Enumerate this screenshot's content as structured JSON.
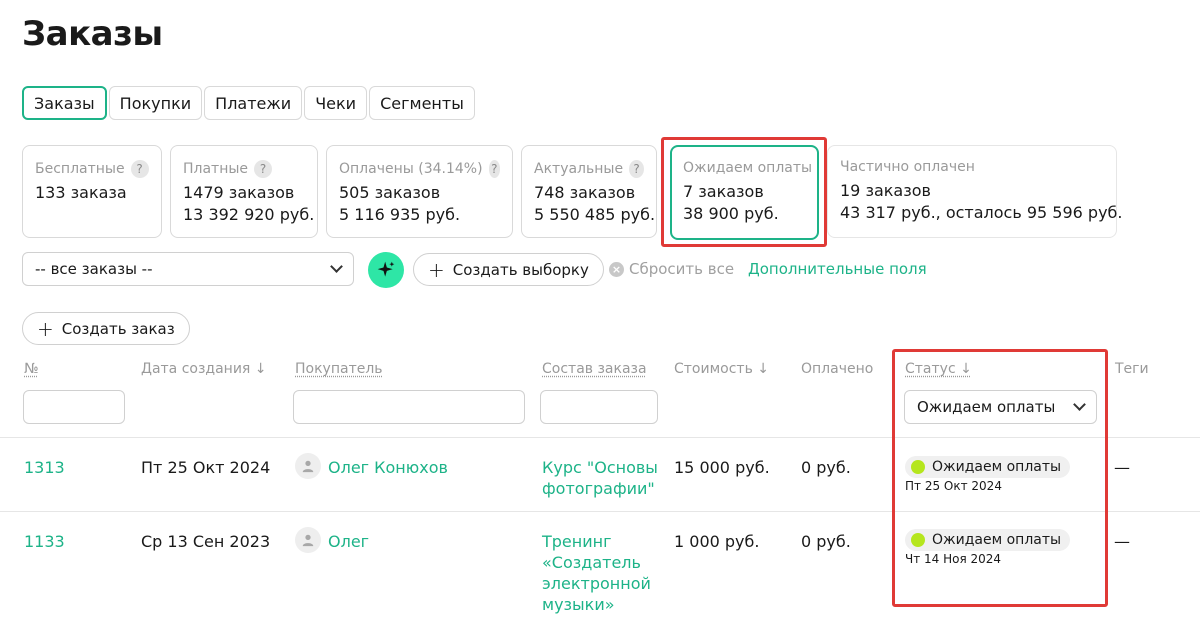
{
  "page": {
    "title": "Заказы"
  },
  "tabs": [
    {
      "label": "Заказы",
      "active": true
    },
    {
      "label": "Покупки"
    },
    {
      "label": "Платежи"
    },
    {
      "label": "Чеки"
    },
    {
      "label": "Сегменты"
    }
  ],
  "cards": [
    {
      "title": "Бесплатные",
      "line1": "133 заказа",
      "line2": ""
    },
    {
      "title": "Платные",
      "line1": "1479 заказов",
      "line2": "13 392 920 руб."
    },
    {
      "title": "Оплачены (34.14%)",
      "line1": "505 заказов",
      "line2": "5 116 935 руб."
    },
    {
      "title": "Актуальные",
      "line1": "748 заказов",
      "line2": "5 550 485 руб."
    },
    {
      "title": "Ожидаем оплаты",
      "line1": "7 заказов",
      "line2": "38 900 руб."
    },
    {
      "title": "Частично оплачен",
      "line1": "19 заказов",
      "line2": "43 317 руб., осталось 95 596 руб."
    }
  ],
  "help_glyph": "?",
  "filters": {
    "segment_select": "-- все заказы --",
    "create_selection": "Создать выборку",
    "reset_all": "Сбросить все",
    "extra_fields": "Дополнительные поля",
    "create_order": "Создать заказ"
  },
  "table": {
    "headers": {
      "number": "№",
      "created": "Дата создания ↓",
      "buyer": "Покупатель",
      "composition": "Состав заказа",
      "price": "Стоимость ↓",
      "paid": "Оплачено",
      "status": "Статус ↓",
      "tags": "Теги"
    },
    "status_filter": "Ожидаем оплаты",
    "rows": [
      {
        "id": "1313",
        "date": "Пт 25 Окт 2024",
        "buyer": "Олег Конюхов",
        "composition": "Курс \"Основы фотографии\"",
        "price": "15 000 руб.",
        "paid": "0 руб.",
        "status": "Ожидаем оплаты",
        "status_date": "Пт 25 Окт 2024",
        "tags": "—"
      },
      {
        "id": "1133",
        "date": "Ср 13 Сен 2023",
        "buyer": "Олег",
        "composition": "Тренинг «Создатель электронной музыки»",
        "price": "1 000 руб.",
        "paid": "0 руб.",
        "status": "Ожидаем оплаты",
        "status_date": "Чт 14 Ноя 2024",
        "tags": "—"
      }
    ]
  },
  "colors": {
    "accent": "#1db388",
    "highlight": "#e03a36",
    "status_dot": "#b5e61d",
    "sparkle_bg": "#2ee6a6"
  }
}
